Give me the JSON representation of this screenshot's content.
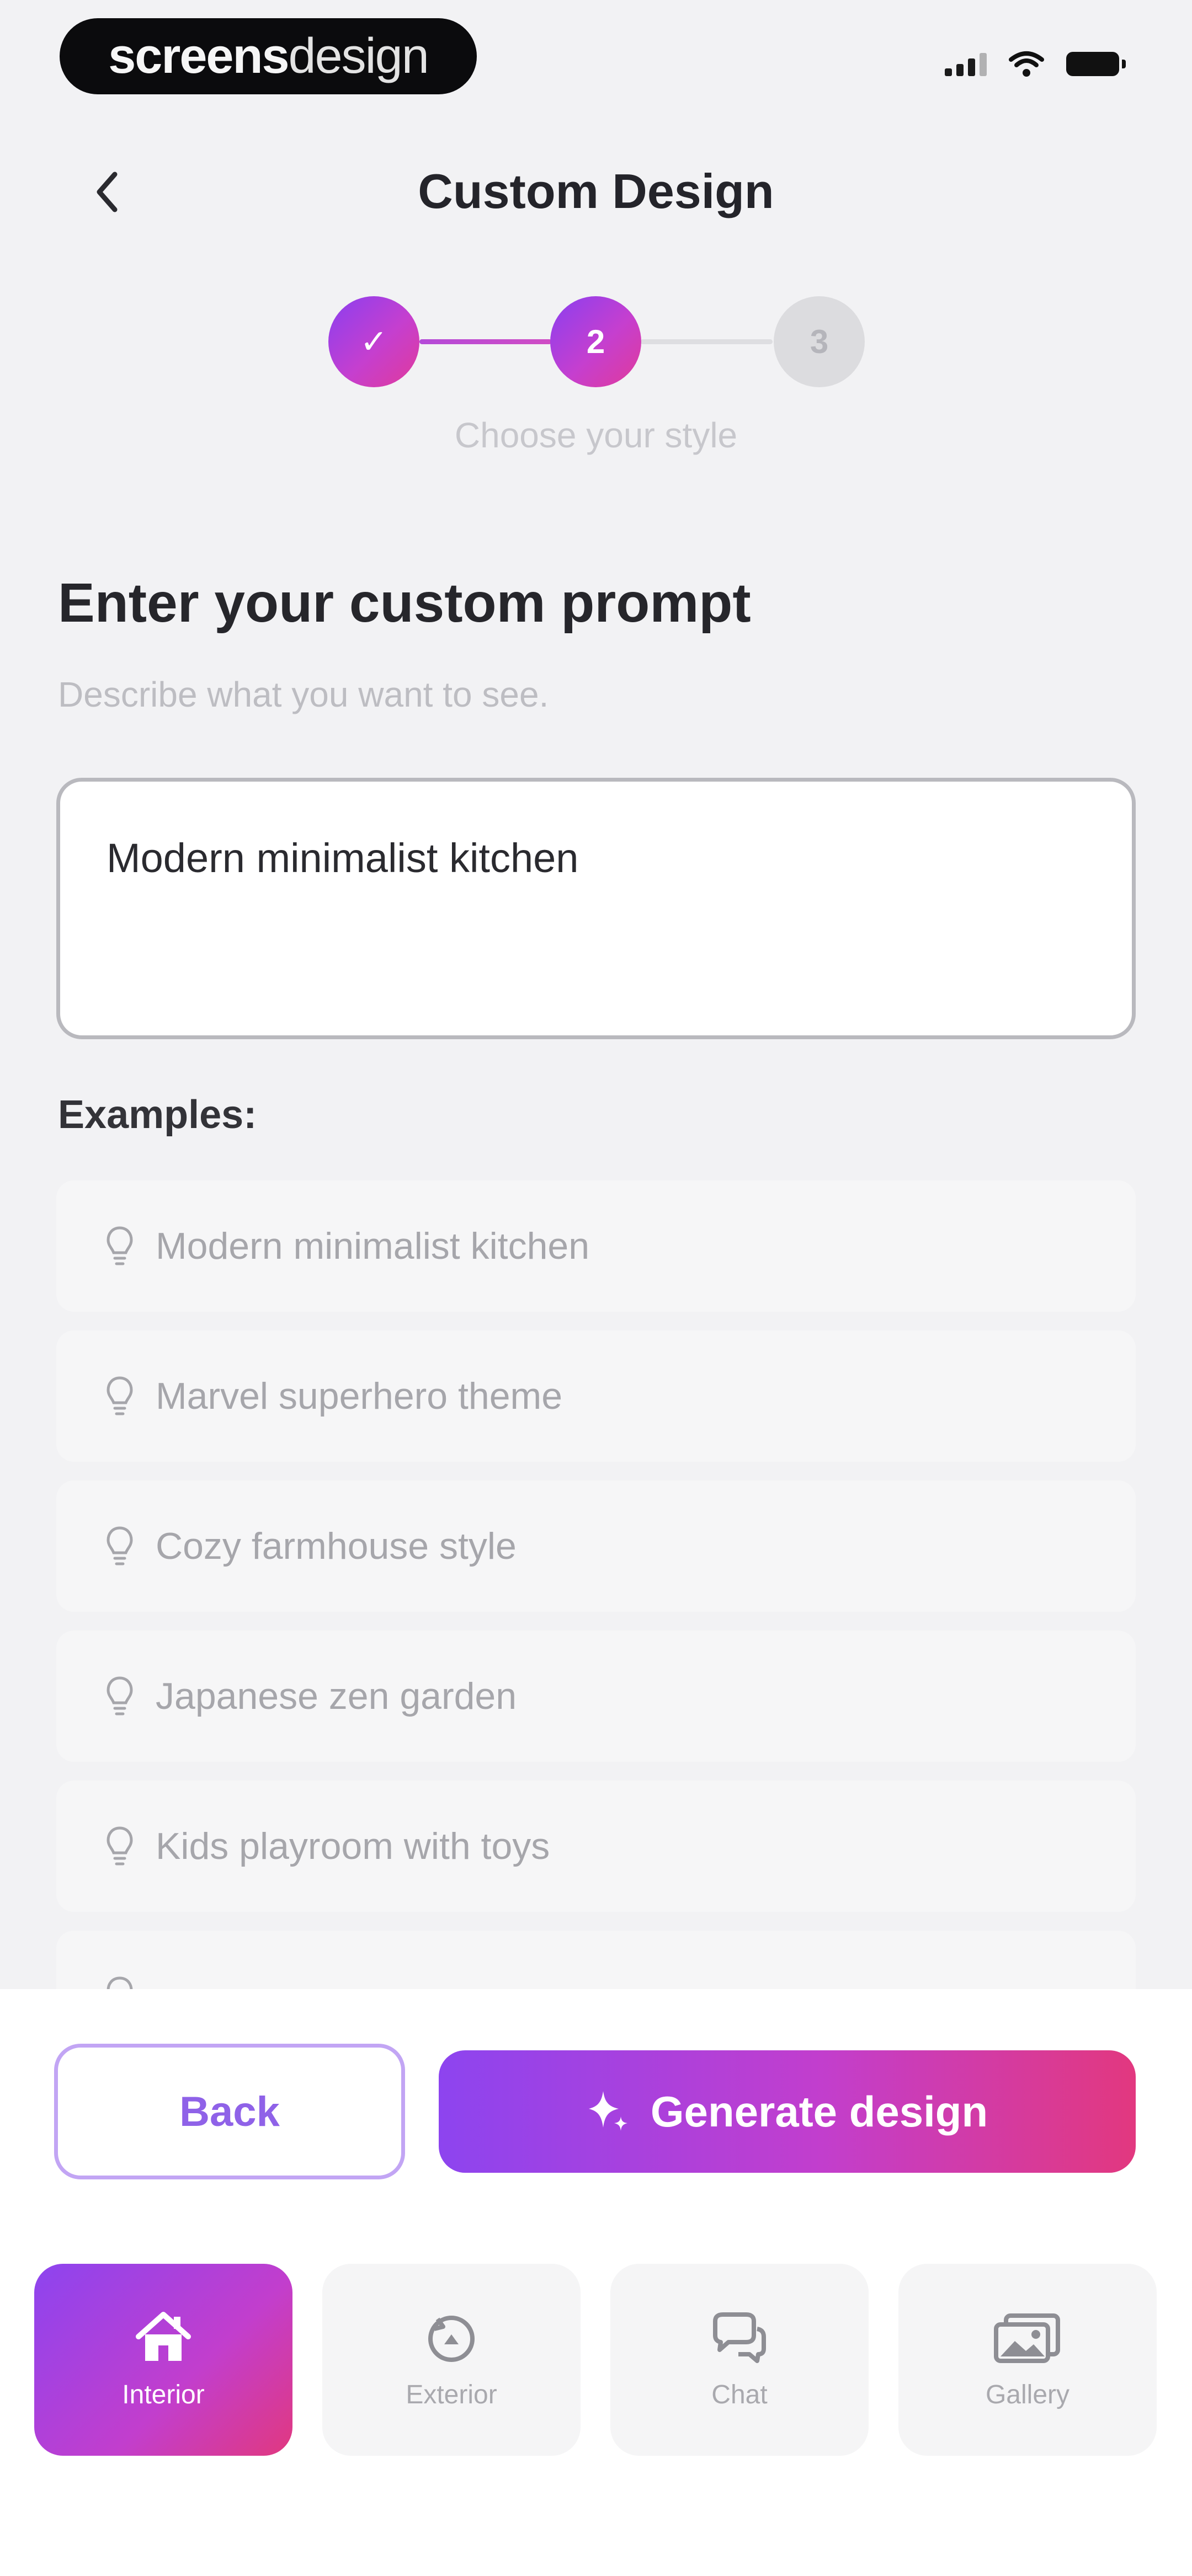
{
  "watermark": {
    "part1": "screens",
    "part2": "design"
  },
  "header": {
    "title": "Custom Design"
  },
  "stepper": {
    "steps": [
      {
        "label": "✓",
        "state": "complete"
      },
      {
        "label": "2",
        "state": "active"
      },
      {
        "label": "3",
        "state": "upcoming"
      }
    ],
    "caption": "Choose your style"
  },
  "prompt": {
    "title": "Enter your custom prompt",
    "subtitle": "Describe what you want to see.",
    "value": "Modern minimalist kitchen"
  },
  "examples": {
    "label": "Examples:",
    "items": [
      "Modern minimalist kitchen",
      "Marvel superhero theme",
      "Cozy farmhouse style",
      "Japanese zen garden",
      "Kids playroom with toys"
    ]
  },
  "actions": {
    "back": "Back",
    "generate": "Generate design"
  },
  "tabs": [
    {
      "label": "Interior",
      "icon": "home-icon",
      "active": true
    },
    {
      "label": "Exterior",
      "icon": "exterior-icon",
      "active": false
    },
    {
      "label": "Chat",
      "icon": "chat-icon",
      "active": false
    },
    {
      "label": "Gallery",
      "icon": "gallery-icon",
      "active": false
    }
  ],
  "colors": {
    "accent_start": "#8d44ef",
    "accent_end": "#e2387f",
    "inactive_step": "#dcdcdf"
  }
}
